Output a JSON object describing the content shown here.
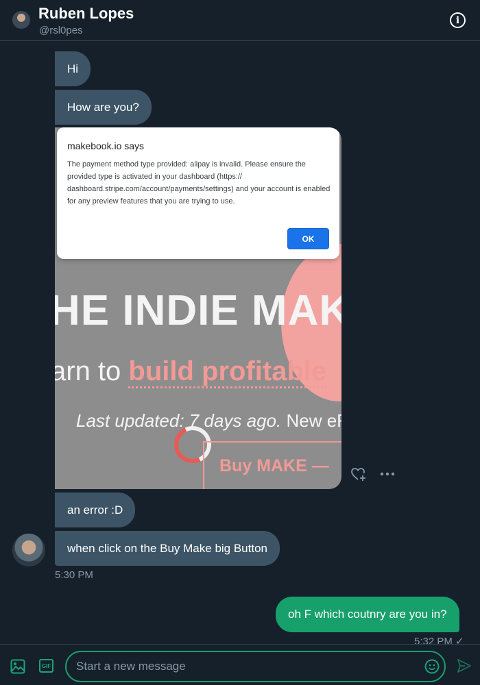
{
  "header": {
    "name": "Ruben Lopes",
    "handle": "@rsl0pes",
    "info_icon": "info-icon"
  },
  "messages": [
    {
      "text": "Hi",
      "direction": "in"
    },
    {
      "text": "How are you?",
      "direction": "in"
    },
    {
      "text": "an error :D",
      "direction": "in"
    },
    {
      "text": "when click on the Buy Make big Button",
      "direction": "in"
    },
    {
      "text": "oh F which coutnry are you in?",
      "direction": "out"
    }
  ],
  "timestamps": {
    "incoming": "5:30 PM",
    "outgoing": "5:32 PM",
    "read_mark": "✓"
  },
  "attachment": {
    "dialog_title": "makebook.io says",
    "dialog_message": "The payment method type provided: alipay is invalid. Please ensure the provided type is activated in your dashboard (https:// dashboard.stripe.com/account/payments/settings) and your account is enabled for any preview features that you are trying to use.",
    "dialog_ok": "OK",
    "headline": "HE INDIE MAK",
    "subline_plain": "arn to ",
    "subline_highlight": "build profitable",
    "updated_italic": "Last updated: 7 days ago.",
    "updated_plain": " New eF",
    "buy_button": "Buy MAKE —"
  },
  "composer": {
    "placeholder": "Start a new message",
    "gif_label": "GIF"
  },
  "colors": {
    "background": "#15202b",
    "incoming_bubble": "#3d5466",
    "outgoing_bubble": "#17a06c",
    "accent": "#1da37a"
  }
}
